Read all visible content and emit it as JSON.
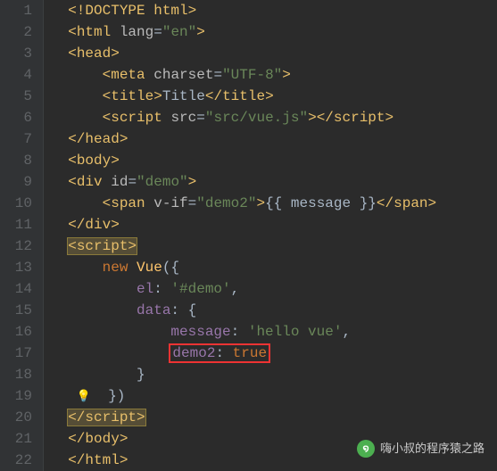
{
  "lines": [
    "1",
    "2",
    "3",
    "4",
    "5",
    "6",
    "7",
    "8",
    "9",
    "10",
    "11",
    "12",
    "13",
    "14",
    "15",
    "16",
    "17",
    "18",
    "19",
    "20",
    "21",
    "22"
  ],
  "code": {
    "l1": {
      "doctype": "<!DOCTYPE html>"
    },
    "l2": {
      "open": "<",
      "tag": "html",
      "sp": " ",
      "attr": "lang",
      "eq": "=",
      "val": "\"en\"",
      "close": ">"
    },
    "l3": {
      "open": "<",
      "tag": "head",
      "close": ">"
    },
    "l4": {
      "open": "<",
      "tag": "meta",
      "sp": " ",
      "attr": "charset",
      "eq": "=",
      "val": "\"UTF-8\"",
      "close": ">"
    },
    "l5": {
      "open": "<",
      "tag": "title",
      "close": ">",
      "text": "Title",
      "open2": "</",
      "tag2": "title",
      "close2": ">"
    },
    "l6": {
      "open": "<",
      "tag": "script",
      "sp": " ",
      "attr": "src",
      "eq": "=",
      "val": "\"src/vue.js\"",
      "close": ">",
      "open2": "</",
      "tag2": "script",
      "close2": ">"
    },
    "l7": {
      "open": "</",
      "tag": "head",
      "close": ">"
    },
    "l8": {
      "open": "<",
      "tag": "body",
      "close": ">"
    },
    "l9": {
      "open": "<",
      "tag": "div",
      "sp": " ",
      "attr": "id",
      "eq": "=",
      "val": "\"demo\"",
      "close": ">"
    },
    "l10": {
      "open": "<",
      "tag": "span",
      "sp": " ",
      "attr": "v-if",
      "eq": "=",
      "val": "\"demo2\"",
      "close": ">",
      "text": "{{ message }}",
      "open2": "</",
      "tag2": "span",
      "close2": ">"
    },
    "l11": {
      "open": "</",
      "tag": "div",
      "close": ">"
    },
    "l12": {
      "open": "<",
      "tag": "script",
      "close": ">"
    },
    "l13": {
      "kw": "new",
      "sp": " ",
      "fn": "Vue",
      "paren": "({"
    },
    "l14": {
      "prop": "el",
      "colon": ": ",
      "val": "'#demo'",
      "comma": ","
    },
    "l15": {
      "prop": "data",
      "colon": ": ",
      "brace": "{"
    },
    "l16": {
      "prop": "message",
      "colon": ": ",
      "val": "'hello vue'",
      "comma": ","
    },
    "l17": {
      "prop": "demo2",
      "colon": ": ",
      "kw": "true"
    },
    "l18": {
      "brace": "}"
    },
    "l19": {
      "close": "})"
    },
    "l20": {
      "open": "</",
      "tag": "script",
      "close": ">"
    },
    "l21": {
      "open": "</",
      "tag": "body",
      "close": ">"
    },
    "l22": {
      "open": "</",
      "tag": "html",
      "close": ">"
    }
  },
  "watermark": "嗨小叔的程序猿之路",
  "watermark_icon": "●●"
}
